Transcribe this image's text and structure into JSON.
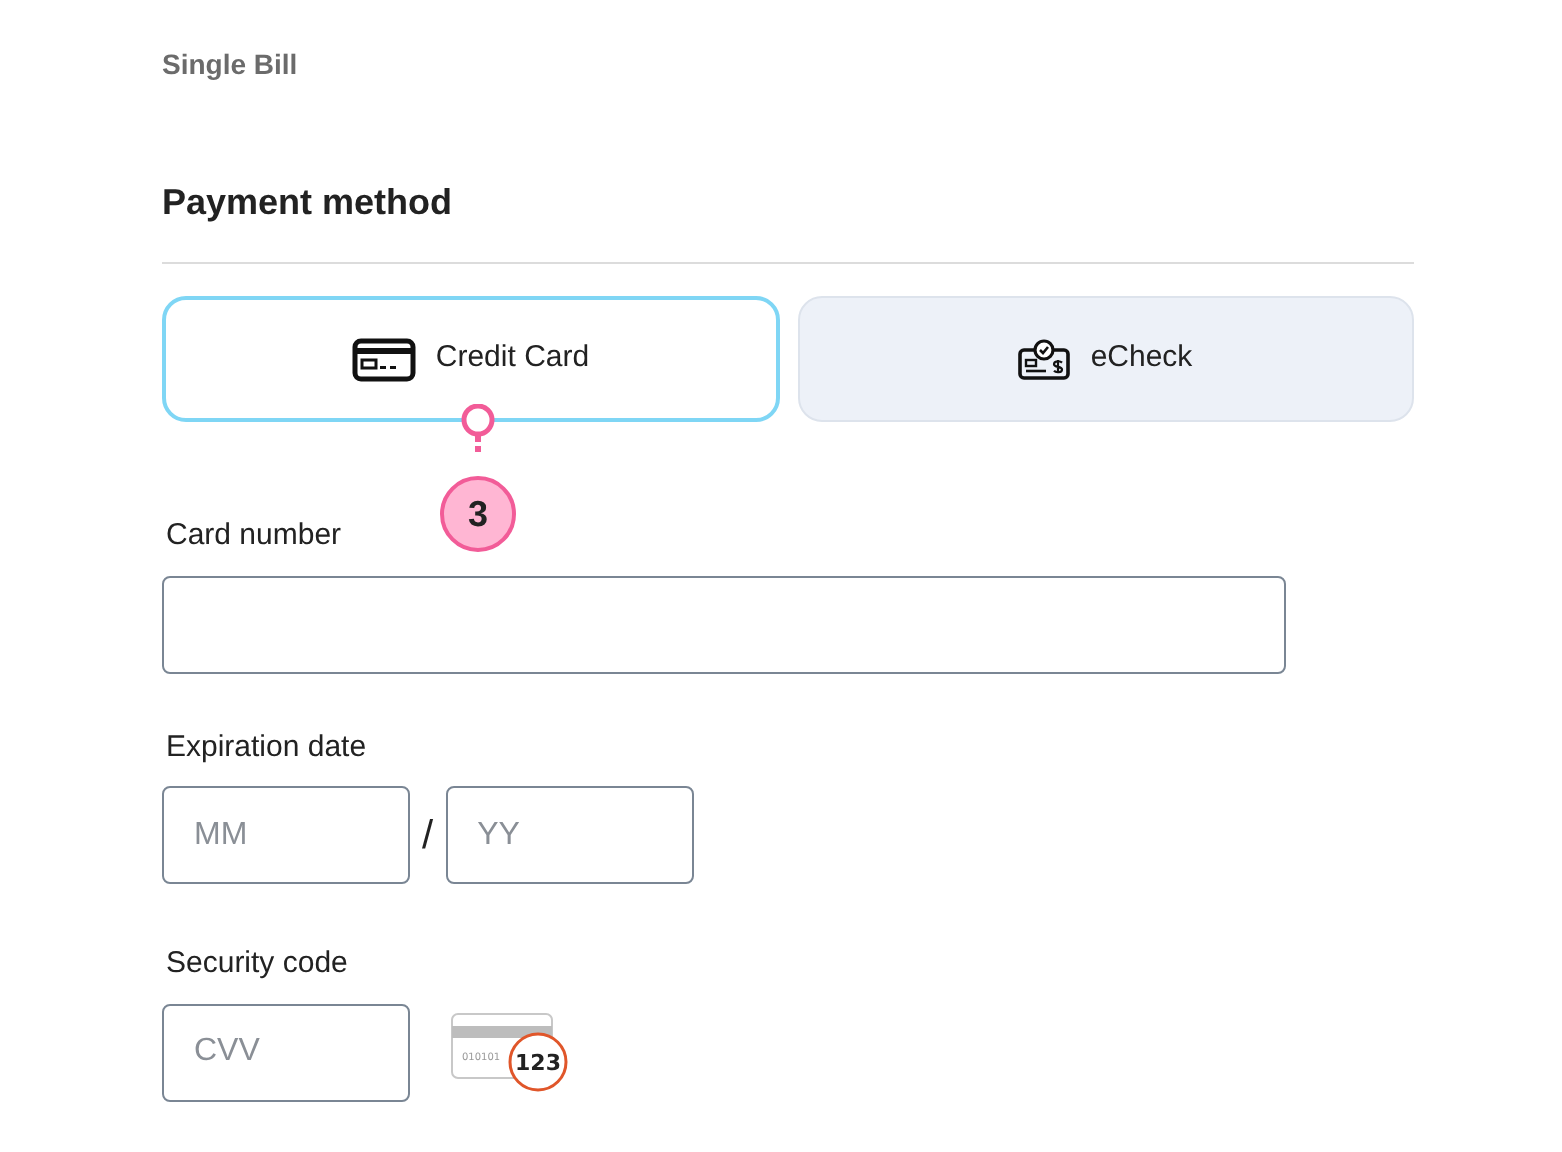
{
  "heading": "Single Bill",
  "section_title": "Payment method",
  "methods": [
    {
      "label": "Credit Card",
      "kind": "card",
      "selected": true
    },
    {
      "label": "eCheck",
      "kind": "check",
      "selected": false
    }
  ],
  "callout": {
    "number": "3"
  },
  "card_number": {
    "label": "Card number"
  },
  "expiration": {
    "label": "Expiration date",
    "month_placeholder": "MM",
    "separator": "/",
    "year_placeholder": "YY"
  },
  "security_code": {
    "label": "Security code",
    "placeholder": "CVV",
    "hint_stripe_text": "010101",
    "hint_digits": "123"
  }
}
